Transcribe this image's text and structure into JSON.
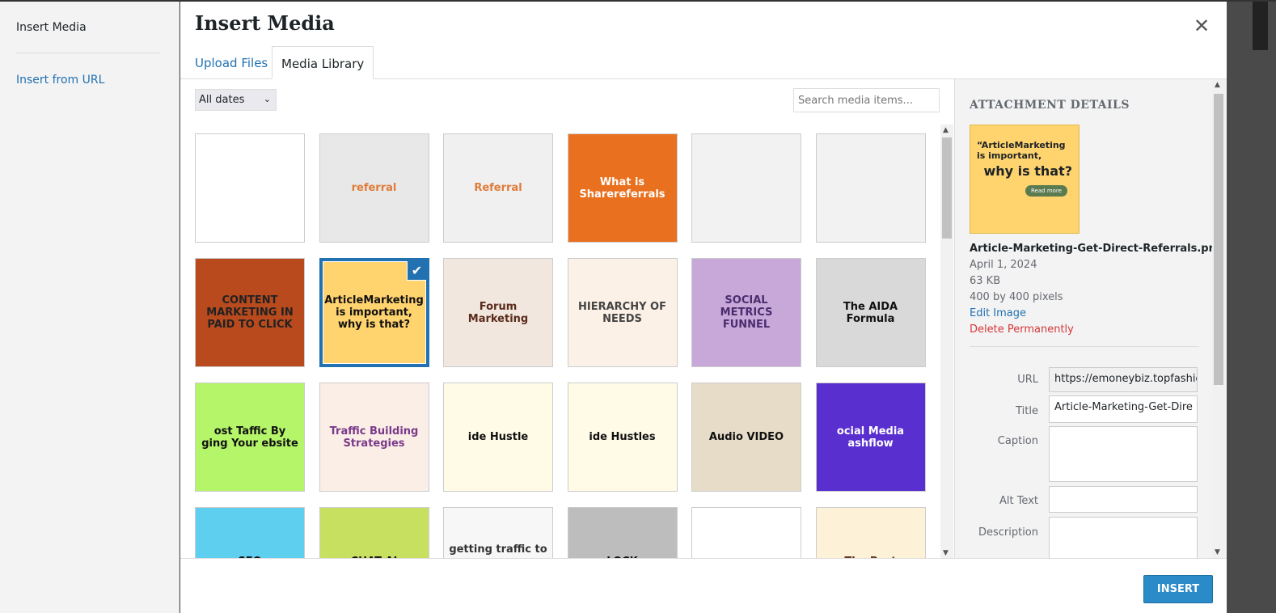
{
  "sidebar": {
    "title": "Insert Media",
    "insert_from_url": "Insert from URL"
  },
  "modal": {
    "title": "Insert Media",
    "close_icon": "close-icon"
  },
  "tabs": [
    {
      "label": "Upload Files"
    },
    {
      "label": "Media Library"
    }
  ],
  "toolbar": {
    "date_filter": "All dates",
    "search_placeholder": "Search media items..."
  },
  "grid": {
    "items": [
      {
        "label": "",
        "bg": "#ffffff",
        "fg": "#2b8a2b"
      },
      {
        "label": "referral",
        "bg": "#e8e8e8",
        "fg": "#e07b39"
      },
      {
        "label": "Referral",
        "bg": "#f0f0f0",
        "fg": "#e07b39"
      },
      {
        "label": "What is Sharereferrals",
        "bg": "#e8701e",
        "fg": "#ffffff"
      },
      {
        "label": "",
        "bg": "#f2f2f2",
        "fg": "#333"
      },
      {
        "label": "",
        "bg": "#f2f2f2",
        "fg": "#333"
      },
      {
        "label": "CONTENT MARKETING IN PAID TO CLICK",
        "bg": "#b84a1e",
        "fg": "#222"
      },
      {
        "label": "ArticleMarketing is important, why is that?",
        "bg": "#ffd36e",
        "fg": "#111",
        "selected": true
      },
      {
        "label": "Forum Marketing",
        "bg": "#f1e7df",
        "fg": "#5a2b1a"
      },
      {
        "label": "HIERARCHY OF NEEDS",
        "bg": "#fbf1e6",
        "fg": "#444"
      },
      {
        "label": "SOCIAL METRICS FUNNEL",
        "bg": "#c8a8d8",
        "fg": "#4a2d6e"
      },
      {
        "label": "The AIDA Formula",
        "bg": "#d9d9d9",
        "fg": "#111"
      },
      {
        "label": "ost Taffic By ging Your ebsite",
        "bg": "#b5f56a",
        "fg": "#111"
      },
      {
        "label": "Traffic Building Strategies",
        "bg": "#fbeee6",
        "fg": "#7a3a8a"
      },
      {
        "label": "ide Hustle",
        "bg": "#fffbe6",
        "fg": "#111"
      },
      {
        "label": "ide Hustles",
        "bg": "#fffbe6",
        "fg": "#111"
      },
      {
        "label": "Audio VIDEO",
        "bg": "#e7dcc8",
        "fg": "#111"
      },
      {
        "label": "ocial Media ashflow",
        "bg": "#5a2fd0",
        "fg": "#ffffff"
      },
      {
        "label": "SEO",
        "bg": "#5fcff0",
        "fg": "#111"
      },
      {
        "label": "CHAT AI",
        "bg": "#c8e060",
        "fg": "#111"
      },
      {
        "label": "getting traffic to your scam marketers",
        "bg": "#f7f7f7",
        "fg": "#333"
      },
      {
        "label": "LOCK",
        "bg": "#bdbdbd",
        "fg": "#111"
      },
      {
        "label": "",
        "bg": "#ffffff",
        "fg": "#333"
      },
      {
        "label": "The Best",
        "bg": "#fdf2d8",
        "fg": "#5a2b1a"
      }
    ]
  },
  "details": {
    "heading": "ATTACHMENT DETAILS",
    "preview": {
      "line1": "“ArticleMarketing is important,",
      "line2": "why is that?",
      "button": "Read more"
    },
    "filename": "Article-Marketing-Get-Direct-Referrals.png",
    "date": "April 1, 2024",
    "size": "63 KB",
    "dimensions": "400 by 400 pixels",
    "edit": "Edit Image",
    "delete": "Delete Permanently",
    "fields": {
      "url_label": "URL",
      "url": "https://emoneybiz.topfashic",
      "title_label": "Title",
      "title": "Article-Marketing-Get-Dire",
      "caption_label": "Caption",
      "caption": "",
      "alt_label": "Alt Text",
      "alt": "",
      "description_label": "Description",
      "description": ""
    }
  },
  "footer": {
    "insert": "INSERT"
  },
  "colors": {
    "accent": "#2271b1",
    "danger": "#d63638",
    "insert_button": "#2a8bc8"
  }
}
